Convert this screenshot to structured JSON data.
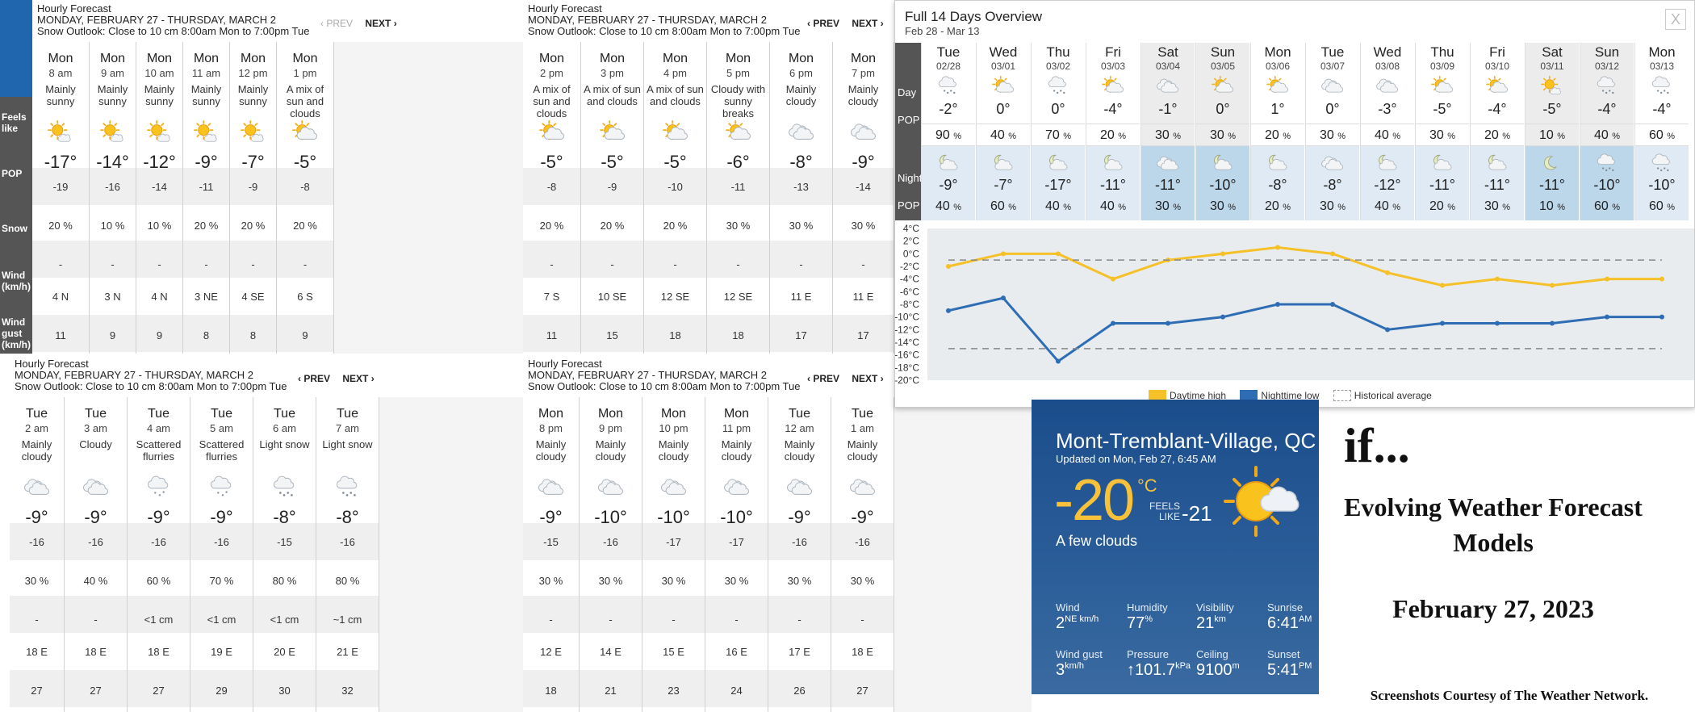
{
  "panels": {
    "p1": {
      "title": "Hourly Forecast",
      "range": "MONDAY, FEBRUARY 27 - THURSDAY, MARCH 2",
      "outlook": "Snow Outlook: Close to 10 cm 8:00am Mon to 7:00pm Tue",
      "prev": "‹ PREV",
      "next": "NEXT ›"
    },
    "p2": {
      "title": "Hourly Forecast",
      "range": "MONDAY, FEBRUARY 27 - THURSDAY, MARCH 2",
      "outlook": "Snow Outlook: Close to 10 cm 8:00am Mon to 7:00pm Tue",
      "prev": "‹ PREV",
      "next": "NEXT ›"
    },
    "p3": {
      "title": "Hourly Forecast",
      "range": "MONDAY, FEBRUARY 27 - THURSDAY, MARCH 2",
      "outlook": "Snow Outlook: Close to 10 cm 8:00am Mon to 7:00pm Tue",
      "prev": "‹ PREV",
      "next": "NEXT ›"
    },
    "p4": {
      "title": "Hourly Forecast",
      "range": "MONDAY, FEBRUARY 27 - THURSDAY, MARCH 2",
      "outlook": "Snow Outlook: Close to 10 cm 8:00am Mon to 7:00pm Tue",
      "prev": "‹ PREV",
      "next": "NEXT ›"
    }
  },
  "row_labels": {
    "feels": "Feels like",
    "pop": "POP",
    "snow": "Snow",
    "wind": "Wind (km/h)",
    "gust": "Wind gust (km/h)"
  },
  "hourly": {
    "p1": [
      {
        "day": "Mon",
        "time": "8 am",
        "desc": "Mainly sunny",
        "icon": "sunny-icon",
        "temp": "-17°",
        "feels": "-19",
        "pop": "20 %",
        "snow": "-",
        "wind": "4 N",
        "gust": "11"
      },
      {
        "day": "Mon",
        "time": "9 am",
        "desc": "Mainly sunny",
        "icon": "sunny-icon",
        "temp": "-14°",
        "feels": "-16",
        "pop": "10 %",
        "snow": "-",
        "wind": "3 N",
        "gust": "9"
      },
      {
        "day": "Mon",
        "time": "10 am",
        "desc": "Mainly sunny",
        "icon": "sunny-icon",
        "temp": "-12°",
        "feels": "-14",
        "pop": "10 %",
        "snow": "-",
        "wind": "4 N",
        "gust": "9"
      },
      {
        "day": "Mon",
        "time": "11 am",
        "desc": "Mainly sunny",
        "icon": "sunny-icon",
        "temp": "-9°",
        "feels": "-11",
        "pop": "20 %",
        "snow": "-",
        "wind": "3 NE",
        "gust": "8"
      },
      {
        "day": "Mon",
        "time": "12 pm",
        "desc": "Mainly sunny",
        "icon": "sunny-icon",
        "temp": "-7°",
        "feels": "-9",
        "pop": "20 %",
        "snow": "-",
        "wind": "4 SE",
        "gust": "8"
      },
      {
        "day": "Mon",
        "time": "1 pm",
        "desc": "A mix of sun and clouds",
        "icon": "sun-cloud-icon",
        "temp": "-5°",
        "feels": "-8",
        "pop": "20 %",
        "snow": "-",
        "wind": "6 S",
        "gust": "9"
      }
    ],
    "p2": [
      {
        "day": "Mon",
        "time": "2 pm",
        "desc": "A mix of sun and clouds",
        "icon": "sun-cloud-icon",
        "temp": "-5°",
        "feels": "-8",
        "pop": "20 %",
        "snow": "-",
        "wind": "7 S",
        "gust": "11"
      },
      {
        "day": "Mon",
        "time": "3 pm",
        "desc": "A mix of sun and clouds",
        "icon": "sun-cloud-icon",
        "temp": "-5°",
        "feels": "-9",
        "pop": "20 %",
        "snow": "-",
        "wind": "10 SE",
        "gust": "15"
      },
      {
        "day": "Mon",
        "time": "4 pm",
        "desc": "A mix of sun and clouds",
        "icon": "sun-cloud-icon",
        "temp": "-5°",
        "feels": "-10",
        "pop": "20 %",
        "snow": "-",
        "wind": "12 SE",
        "gust": "18"
      },
      {
        "day": "Mon",
        "time": "5 pm",
        "desc": "Cloudy with sunny breaks",
        "icon": "sun-cloud-icon",
        "temp": "-6°",
        "feels": "-11",
        "pop": "30 %",
        "snow": "-",
        "wind": "12 SE",
        "gust": "18"
      },
      {
        "day": "Mon",
        "time": "6 pm",
        "desc": "Mainly cloudy",
        "icon": "cloud-icon",
        "temp": "-8°",
        "feels": "-13",
        "pop": "30 %",
        "snow": "-",
        "wind": "11 E",
        "gust": "17"
      },
      {
        "day": "Mon",
        "time": "7 pm",
        "desc": "Mainly cloudy",
        "icon": "cloud-icon",
        "temp": "-9°",
        "feels": "-14",
        "pop": "30 %",
        "snow": "-",
        "wind": "11 E",
        "gust": "17"
      }
    ],
    "p3": [
      {
        "day": "Tue",
        "time": "2 am",
        "desc": "Mainly cloudy",
        "icon": "cloud-icon",
        "temp": "-9°",
        "feels": "-16",
        "pop": "30 %",
        "snow": "-",
        "wind": "18 E",
        "gust": "27"
      },
      {
        "day": "Tue",
        "time": "3 am",
        "desc": "Cloudy",
        "icon": "cloud-icon",
        "temp": "-9°",
        "feels": "-16",
        "pop": "40 %",
        "snow": "-",
        "wind": "18 E",
        "gust": "27"
      },
      {
        "day": "Tue",
        "time": "4 am",
        "desc": "Scattered flurries",
        "icon": "flurries-icon",
        "temp": "-9°",
        "feels": "-16",
        "pop": "60 %",
        "snow": "<1 cm",
        "wind": "18 E",
        "gust": "27"
      },
      {
        "day": "Tue",
        "time": "5 am",
        "desc": "Scattered flurries",
        "icon": "flurries-icon",
        "temp": "-9°",
        "feels": "-16",
        "pop": "70 %",
        "snow": "<1 cm",
        "wind": "19 E",
        "gust": "29"
      },
      {
        "day": "Tue",
        "time": "6 am",
        "desc": "Light snow",
        "icon": "snow-icon",
        "temp": "-8°",
        "feels": "-15",
        "pop": "80 %",
        "snow": "<1 cm",
        "wind": "20 E",
        "gust": "30"
      },
      {
        "day": "Tue",
        "time": "7 am",
        "desc": "Light snow",
        "icon": "snow-icon",
        "temp": "-8°",
        "feels": "-16",
        "pop": "80 %",
        "snow": "~1 cm",
        "wind": "21 E",
        "gust": "32"
      }
    ],
    "p4": [
      {
        "day": "Mon",
        "time": "8 pm",
        "desc": "Mainly cloudy",
        "icon": "cloud-icon",
        "temp": "-9°",
        "feels": "-15",
        "pop": "30 %",
        "snow": "-",
        "wind": "12 E",
        "gust": "18"
      },
      {
        "day": "Mon",
        "time": "9 pm",
        "desc": "Mainly cloudy",
        "icon": "cloud-icon",
        "temp": "-10°",
        "feels": "-16",
        "pop": "30 %",
        "snow": "-",
        "wind": "14 E",
        "gust": "21"
      },
      {
        "day": "Mon",
        "time": "10 pm",
        "desc": "Mainly cloudy",
        "icon": "cloud-icon",
        "temp": "-10°",
        "feels": "-17",
        "pop": "30 %",
        "snow": "-",
        "wind": "15 E",
        "gust": "23"
      },
      {
        "day": "Mon",
        "time": "11 pm",
        "desc": "Mainly cloudy",
        "icon": "cloud-icon",
        "temp": "-10°",
        "feels": "-17",
        "pop": "30 %",
        "snow": "-",
        "wind": "16 E",
        "gust": "24"
      },
      {
        "day": "Tue",
        "time": "12 am",
        "desc": "Mainly cloudy",
        "icon": "cloud-icon",
        "temp": "-9°",
        "feels": "-16",
        "pop": "30 %",
        "snow": "-",
        "wind": "17 E",
        "gust": "26"
      },
      {
        "day": "Tue",
        "time": "1 am",
        "desc": "Mainly cloudy",
        "icon": "cloud-icon",
        "temp": "-9°",
        "feels": "-16",
        "pop": "30 %",
        "snow": "-",
        "wind": "18 E",
        "gust": "27"
      }
    ]
  },
  "overview": {
    "title": "Full 14 Days Overview",
    "subtitle": "Feb 28 - Mar 13",
    "close": "X",
    "labels": {
      "day": "Day",
      "pop": "POP",
      "night": "Night",
      "npop": "POP"
    },
    "days": [
      {
        "d": "Tue",
        "date": "02/28",
        "hi": "-2°",
        "pop": "90",
        "lo": "-9°",
        "npop": "40"
      },
      {
        "d": "Wed",
        "date": "03/01",
        "hi": "0°",
        "pop": "40",
        "lo": "-7°",
        "npop": "60"
      },
      {
        "d": "Thu",
        "date": "03/02",
        "hi": "0°",
        "pop": "70",
        "lo": "-17°",
        "npop": "40"
      },
      {
        "d": "Fri",
        "date": "03/03",
        "hi": "-4°",
        "pop": "20",
        "lo": "-11°",
        "npop": "40"
      },
      {
        "d": "Sat",
        "date": "03/04",
        "hi": "-1°",
        "pop": "30",
        "lo": "-11°",
        "npop": "30"
      },
      {
        "d": "Sun",
        "date": "03/05",
        "hi": "0°",
        "pop": "30",
        "lo": "-10°",
        "npop": "30"
      },
      {
        "d": "Mon",
        "date": "03/06",
        "hi": "1°",
        "pop": "20",
        "lo": "-8°",
        "npop": "20"
      },
      {
        "d": "Tue",
        "date": "03/07",
        "hi": "0°",
        "pop": "30",
        "lo": "-8°",
        "npop": "30"
      },
      {
        "d": "Wed",
        "date": "03/08",
        "hi": "-3°",
        "pop": "40",
        "lo": "-12°",
        "npop": "40"
      },
      {
        "d": "Thu",
        "date": "03/09",
        "hi": "-5°",
        "pop": "30",
        "lo": "-11°",
        "npop": "20"
      },
      {
        "d": "Fri",
        "date": "03/10",
        "hi": "-4°",
        "pop": "20",
        "lo": "-11°",
        "npop": "30"
      },
      {
        "d": "Sat",
        "date": "03/11",
        "hi": "-5°",
        "pop": "10",
        "lo": "-11°",
        "npop": "10"
      },
      {
        "d": "Sun",
        "date": "03/12",
        "hi": "-4°",
        "pop": "40",
        "lo": "-10°",
        "npop": "60"
      },
      {
        "d": "Mon",
        "date": "03/13",
        "hi": "-4°",
        "pop": "60",
        "lo": "-10°",
        "npop": "60"
      }
    ],
    "pct": "%"
  },
  "chart_data": {
    "type": "line",
    "x": [
      "02/28",
      "03/01",
      "03/02",
      "03/03",
      "03/04",
      "03/05",
      "03/06",
      "03/07",
      "03/08",
      "03/09",
      "03/10",
      "03/11",
      "03/12",
      "03/13"
    ],
    "series": [
      {
        "name": "Daytime high",
        "color": "#f5c028",
        "values": [
          -2,
          0,
          0,
          -4,
          -1,
          0,
          1,
          0,
          -3,
          -5,
          -4,
          -5,
          -4,
          -4
        ]
      },
      {
        "name": "Nighttime low",
        "color": "#2e6db4",
        "values": [
          -9,
          -7,
          -17,
          -11,
          -11,
          -10,
          -8,
          -8,
          -12,
          -11,
          -11,
          -11,
          -10,
          -10
        ]
      },
      {
        "name": "Historical average",
        "color": "#888888",
        "values": [
          -1,
          -1,
          -1,
          -1,
          -1,
          -1,
          -1,
          -1,
          -1,
          -1,
          -1,
          -1,
          -1,
          -1
        ]
      },
      {
        "name": "Historical average low",
        "color": "#888888",
        "values": [
          -15,
          -15,
          -15,
          -15,
          -15,
          -15,
          -15,
          -15,
          -15,
          -15,
          -15,
          -15,
          -15,
          -15
        ]
      }
    ],
    "ylim": [
      -20,
      4
    ],
    "yticks": [
      "4°C",
      "2°C",
      "0°C",
      "-2°C",
      "-4°C",
      "-6°C",
      "-8°C",
      "-10°C",
      "-12°C",
      "-14°C",
      "-16°C",
      "-18°C",
      "-20°C"
    ],
    "legend": [
      "Daytime high",
      "Nighttime low",
      "Historical average"
    ],
    "legend_position": "bottom",
    "grid": false
  },
  "current": {
    "location": "Mont-Tremblant-Village, QC",
    "updated": "Updated on Mon, Feb 27, 6:45 AM",
    "temp": "-20",
    "unit": "°C",
    "feels_label": "FEELS LIKE",
    "feels": "-21",
    "condition": "A few clouds",
    "stats": {
      "wind": {
        "label": "Wind",
        "value": "2",
        "unit": "NE km/h"
      },
      "humidity": {
        "label": "Humidity",
        "value": "77",
        "unit": "%"
      },
      "visibility": {
        "label": "Visibility",
        "value": "21",
        "unit": "km"
      },
      "sunrise": {
        "label": "Sunrise",
        "value": "6:41",
        "unit": "AM"
      },
      "gust": {
        "label": "Wind gust",
        "value": "3",
        "unit": "km/h"
      },
      "pressure": {
        "label": "Pressure",
        "value": "↑101.7",
        "unit": "kPa"
      },
      "ceiling": {
        "label": "Ceiling",
        "value": "9100",
        "unit": "m"
      },
      "sunset": {
        "label": "Sunset",
        "value": "5:41",
        "unit": "PM"
      }
    }
  },
  "caption": {
    "if": "if...",
    "heading": "Evolving Weather Forecast Models",
    "date": "February 27, 2023",
    "credit": "Screenshots Courtesy of The Weather Network."
  }
}
